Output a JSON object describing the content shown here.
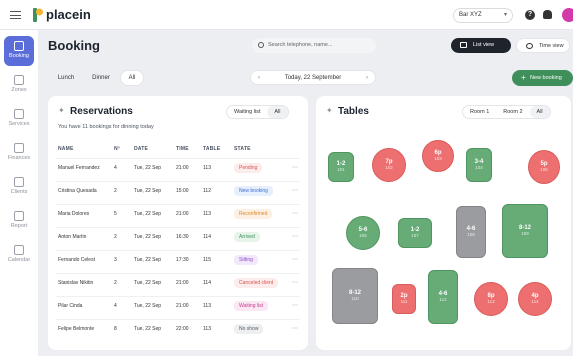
{
  "app": {
    "logo_text": "placein",
    "venue": "Bar XYZ",
    "help_glyph": "?"
  },
  "sidebar": {
    "items": [
      {
        "label": "Booking",
        "icon": "calendar-icon",
        "active": true
      },
      {
        "label": "Zones",
        "icon": "zones-icon",
        "active": false
      },
      {
        "label": "Services",
        "icon": "services-icon",
        "active": false
      },
      {
        "label": "Finances",
        "icon": "finances-icon",
        "active": false
      },
      {
        "label": "Clients",
        "icon": "clients-icon",
        "active": false
      },
      {
        "label": "Report",
        "icon": "report-icon",
        "active": false
      },
      {
        "label": "Calendar",
        "icon": "calendar-icon",
        "active": false
      }
    ]
  },
  "header": {
    "title": "Booking",
    "search_placeholder": "Search telephone, name...",
    "list_view": "List view",
    "time_view": "Time view"
  },
  "filters": {
    "tabs": [
      "Lunch",
      "Dinner",
      "All"
    ],
    "active_tab": "All",
    "date": "Today, 22 September",
    "new_booking": "New booking"
  },
  "reservations": {
    "title": "Reservations",
    "segments": [
      "Waiting list",
      "All"
    ],
    "summary": "You have 11 bookings for dinning today",
    "columns": [
      "NAME",
      "Nº",
      "DATE",
      "TIME",
      "TABLE",
      "STATE"
    ],
    "rows": [
      {
        "name": "Manuel Fernandez",
        "n": "4",
        "date": "Tue, 22 Sep",
        "time": "21:00",
        "table": "113",
        "state": "Pending",
        "kind": "pending"
      },
      {
        "name": "Cristina Quesada",
        "n": "2",
        "date": "Tue, 22 Sep",
        "time": "15:00",
        "table": "112",
        "state": "New booking",
        "kind": "new"
      },
      {
        "name": "Maria Dolores",
        "n": "5",
        "date": "Tue, 22 Sep",
        "time": "21:00",
        "table": "113",
        "state": "Reconfirmed",
        "kind": "reconfirmed"
      },
      {
        "name": "Anton Martin",
        "n": "2",
        "date": "Tue, 22 Sep",
        "time": "16:30",
        "table": "114",
        "state": "Arrived",
        "kind": "arrived"
      },
      {
        "name": "Fernando Celest",
        "n": "3",
        "date": "Tue, 22 Sep",
        "time": "17:30",
        "table": "115",
        "state": "Sitting",
        "kind": "sitting"
      },
      {
        "name": "Stanislav Nikitin",
        "n": "2",
        "date": "Tue, 22 Sep",
        "time": "21:00",
        "table": "114",
        "state": "Canceled client",
        "kind": "canceled"
      },
      {
        "name": "Pilar Cinda",
        "n": "4",
        "date": "Tue, 22 Sep",
        "time": "21:00",
        "table": "113",
        "state": "Waiting list",
        "kind": "waiting"
      },
      {
        "name": "Felipe Belmonte",
        "n": "8",
        "date": "Tue, 22 Sep",
        "time": "22:00",
        "table": "113",
        "state": "No show",
        "kind": "noshow"
      }
    ]
  },
  "status_colors": {
    "pending": {
      "bg": "#fdecec",
      "fg": "#d9534f"
    },
    "new": {
      "bg": "#e6effc",
      "fg": "#3c6fd1"
    },
    "reconfirmed": {
      "bg": "#fdf0e3",
      "fg": "#d98a2b"
    },
    "arrived": {
      "bg": "#e6f4ea",
      "fg": "#3f8f5b"
    },
    "sitting": {
      "bg": "#f3e8fb",
      "fg": "#8e4bc4"
    },
    "canceled": {
      "bg": "#fdecec",
      "fg": "#d9534f"
    },
    "waiting": {
      "bg": "#fbe6f3",
      "fg": "#c2408f"
    },
    "noshow": {
      "bg": "#eeeff1",
      "fg": "#555c66"
    }
  },
  "tables_panel": {
    "title": "Tables",
    "segments": [
      "Room 1",
      "Room 2",
      "All"
    ],
    "tables": [
      {
        "label": "1-2",
        "cover": "101",
        "color": "green"
      },
      {
        "label": "7p",
        "cover": "102",
        "color": "red"
      },
      {
        "label": "6p",
        "cover": "103",
        "color": "red"
      },
      {
        "label": "3-4",
        "cover": "104",
        "color": "green"
      },
      {
        "label": "5p",
        "cover": "105",
        "color": "red"
      },
      {
        "label": "5-6",
        "cover": "106",
        "color": "green"
      },
      {
        "label": "1-2",
        "cover": "107",
        "color": "green"
      },
      {
        "label": "4-6",
        "cover": "108",
        "color": "gray"
      },
      {
        "label": "8-12",
        "cover": "109",
        "color": "green"
      },
      {
        "label": "8-12",
        "cover": "110",
        "color": "gray"
      },
      {
        "label": "2p",
        "cover": "111",
        "color": "red"
      },
      {
        "label": "4-6",
        "cover": "112",
        "color": "green"
      },
      {
        "label": "8p",
        "cover": "113",
        "color": "red"
      },
      {
        "label": "4p",
        "cover": "114",
        "color": "red"
      }
    ]
  }
}
